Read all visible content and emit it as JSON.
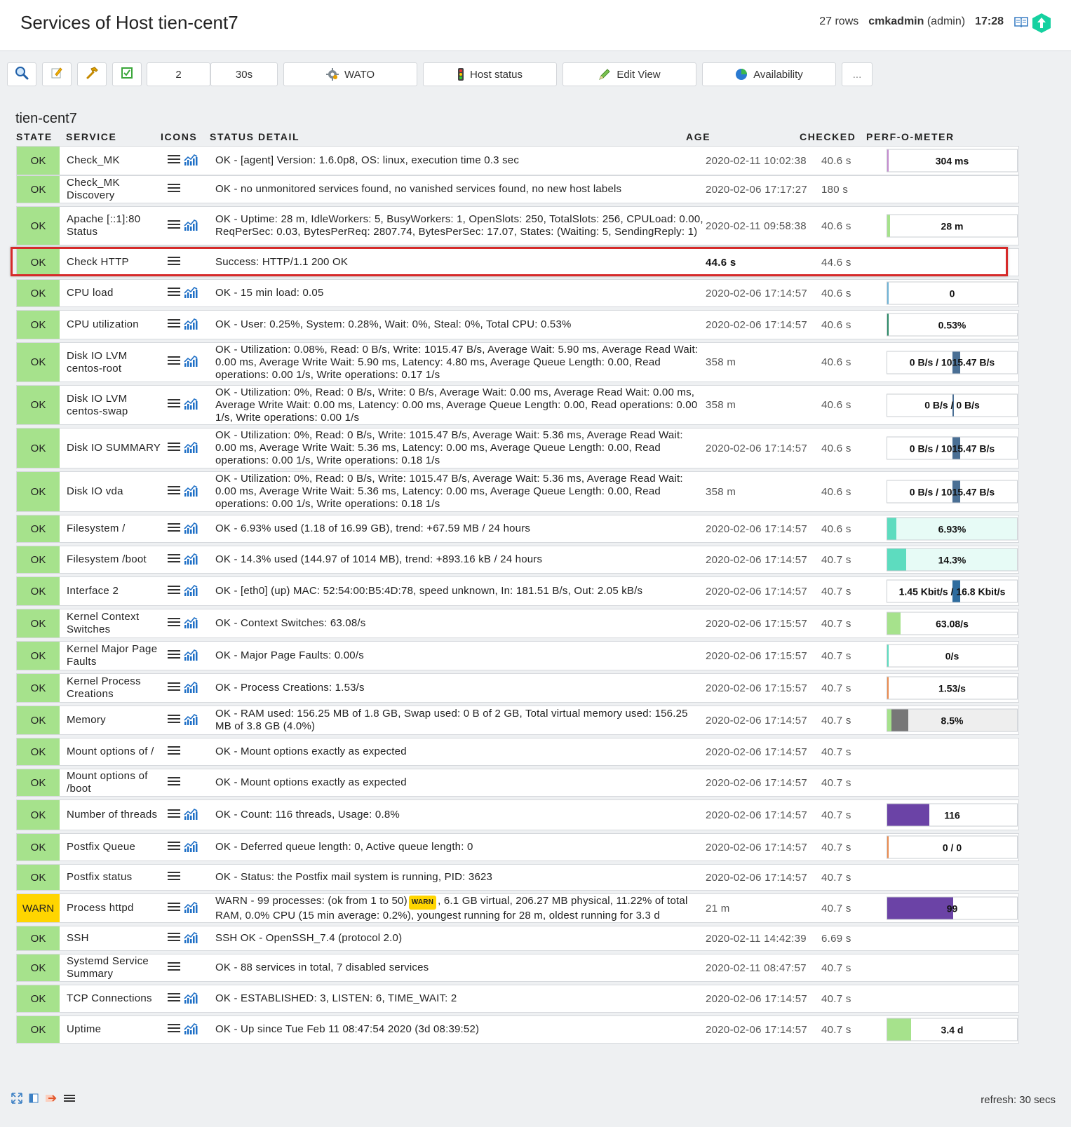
{
  "header": {
    "title": "Services of Host tien-cent7",
    "rows": "27 rows",
    "user": "cmkadmin",
    "role": "(admin)",
    "time": "17:28"
  },
  "toolbar": {
    "refresh_count": "2",
    "refresh_interval": "30s",
    "wato": "WATO",
    "host_status": "Host status",
    "edit_view": "Edit View",
    "availability": "Availability",
    "more": "..."
  },
  "host": "tien-cent7",
  "columns": {
    "state": "STATE",
    "service": "SERVICE",
    "icons": "ICONS",
    "detail": "STATUS DETAIL",
    "age": "AGE",
    "checked": "CHECKED",
    "perf": "PERF-O-METER"
  },
  "services": [
    {
      "state": "OK",
      "service": "Check_MK",
      "detail": "OK - [agent] Version: 1.6.0p8, OS: linux, execution time 0.3 sec",
      "age": "2020-02-11 10:02:38",
      "checked": "40.6 s",
      "perf": "304 ms",
      "graph": true
    },
    {
      "state": "OK",
      "service": "Check_MK Discovery",
      "detail": "OK - no unmonitored services found, no vanished services found, no new host labels",
      "age": "2020-02-06 17:17:27",
      "checked": "180 s",
      "perf": "",
      "graph": false
    },
    {
      "state": "OK",
      "service": "Apache [::1]:80 Status",
      "detail": "OK - Uptime: 28 m, IdleWorkers: 5, BusyWorkers: 1, OpenSlots: 250, TotalSlots: 256, CPULoad: 0.00, ReqPerSec: 0.03, BytesPerReq: 2807.74, BytesPerSec: 17.07, States: (Waiting: 5, SendingReply: 1)",
      "age": "2020-02-11 09:58:38",
      "checked": "40.6 s",
      "perf": "28 m",
      "graph": true
    },
    {
      "state": "OK",
      "service": "Check HTTP",
      "detail": "Success: HTTP/1.1 200 OK",
      "age": "44.6 s",
      "checked": "44.6 s",
      "perf": "",
      "graph": false
    },
    {
      "state": "OK",
      "service": "CPU load",
      "detail": "OK - 15 min load: 0.05",
      "age": "2020-02-06 17:14:57",
      "checked": "40.6 s",
      "perf": "0",
      "graph": true
    },
    {
      "state": "OK",
      "service": "CPU utilization",
      "detail": "OK - User: 0.25%, System: 0.28%, Wait: 0%, Steal: 0%, Total CPU: 0.53%",
      "age": "2020-02-06 17:14:57",
      "checked": "40.6 s",
      "perf": "0.53%",
      "graph": true
    },
    {
      "state": "OK",
      "service": "Disk IO LVM centos-root",
      "detail": "OK - Utilization: 0.08%, Read: 0 B/s, Write: 1015.47 B/s, Average Wait: 5.90 ms, Average Read Wait: 0.00 ms, Average Write Wait: 5.90 ms, Latency: 4.80 ms, Average Queue Length: 0.00, Read operations: 0.00 1/s, Write operations: 0.17 1/s",
      "age": "358 m",
      "checked": "40.6 s",
      "perf": "0 B/s / 1015.47 B/s",
      "graph": true
    },
    {
      "state": "OK",
      "service": "Disk IO LVM centos-swap",
      "detail": "OK - Utilization: 0%, Read: 0 B/s, Write: 0 B/s, Average Wait: 0.00 ms, Average Read Wait: 0.00 ms, Average Write Wait: 0.00 ms, Latency: 0.00 ms, Average Queue Length: 0.00, Read operations: 0.00 1/s, Write operations: 0.00 1/s",
      "age": "358 m",
      "checked": "40.6 s",
      "perf": "0 B/s / 0 B/s",
      "graph": true
    },
    {
      "state": "OK",
      "service": "Disk IO SUMMARY",
      "detail": "OK - Utilization: 0%, Read: 0 B/s, Write: 1015.47 B/s, Average Wait: 5.36 ms, Average Read Wait: 0.00 ms, Average Write Wait: 5.36 ms, Latency: 0.00 ms, Average Queue Length: 0.00, Read operations: 0.00 1/s, Write operations: 0.18 1/s",
      "age": "2020-02-06 17:14:57",
      "checked": "40.6 s",
      "perf": "0 B/s / 1015.47 B/s",
      "graph": true
    },
    {
      "state": "OK",
      "service": "Disk IO vda",
      "detail": "OK - Utilization: 0%, Read: 0 B/s, Write: 1015.47 B/s, Average Wait: 5.36 ms, Average Read Wait: 0.00 ms, Average Write Wait: 5.36 ms, Latency: 0.00 ms, Average Queue Length: 0.00, Read operations: 0.00 1/s, Write operations: 0.18 1/s",
      "age": "358 m",
      "checked": "40.6 s",
      "perf": "0 B/s / 1015.47 B/s",
      "graph": true
    },
    {
      "state": "OK",
      "service": "Filesystem /",
      "detail": "OK - 6.93% used (1.18 of 16.99 GB), trend: +67.59 MB / 24 hours",
      "age": "2020-02-06 17:14:57",
      "checked": "40.6 s",
      "perf": "6.93%",
      "graph": true
    },
    {
      "state": "OK",
      "service": "Filesystem /boot",
      "detail": "OK - 14.3% used (144.97 of 1014 MB), trend: +893.16 kB / 24 hours",
      "age": "2020-02-06 17:14:57",
      "checked": "40.7 s",
      "perf": "14.3%",
      "graph": true
    },
    {
      "state": "OK",
      "service": "Interface 2",
      "detail": "OK - [eth0] (up) MAC: 52:54:00:B5:4D:78, speed unknown, In: 181.51 B/s, Out: 2.05 kB/s",
      "age": "2020-02-06 17:14:57",
      "checked": "40.7 s",
      "perf": "1.45 Kbit/s / 16.8 Kbit/s",
      "graph": true
    },
    {
      "state": "OK",
      "service": "Kernel Context Switches",
      "detail": "OK - Context Switches: 63.08/s",
      "age": "2020-02-06 17:15:57",
      "checked": "40.7 s",
      "perf": "63.08/s",
      "graph": true
    },
    {
      "state": "OK",
      "service": "Kernel Major Page Faults",
      "detail": "OK - Major Page Faults: 0.00/s",
      "age": "2020-02-06 17:15:57",
      "checked": "40.7 s",
      "perf": "0/s",
      "graph": true
    },
    {
      "state": "OK",
      "service": "Kernel Process Creations",
      "detail": "OK - Process Creations: 1.53/s",
      "age": "2020-02-06 17:15:57",
      "checked": "40.7 s",
      "perf": "1.53/s",
      "graph": true
    },
    {
      "state": "OK",
      "service": "Memory",
      "detail": "OK - RAM used: 156.25 MB of 1.8 GB, Swap used: 0 B of 2 GB, Total virtual memory used: 156.25 MB of 3.8 GB (4.0%)",
      "age": "2020-02-06 17:14:57",
      "checked": "40.7 s",
      "perf": "8.5%",
      "graph": true
    },
    {
      "state": "OK",
      "service": "Mount options of /",
      "detail": "OK - Mount options exactly as expected",
      "age": "2020-02-06 17:14:57",
      "checked": "40.7 s",
      "perf": "",
      "graph": false
    },
    {
      "state": "OK",
      "service": "Mount options of /boot",
      "detail": "OK - Mount options exactly as expected",
      "age": "2020-02-06 17:14:57",
      "checked": "40.7 s",
      "perf": "",
      "graph": false
    },
    {
      "state": "OK",
      "service": "Number of threads",
      "detail": "OK - Count: 116 threads, Usage: 0.8%",
      "age": "2020-02-06 17:14:57",
      "checked": "40.7 s",
      "perf": "116",
      "graph": true
    },
    {
      "state": "OK",
      "service": "Postfix Queue",
      "detail": "OK - Deferred queue length: 0, Active queue length: 0",
      "age": "2020-02-06 17:14:57",
      "checked": "40.7 s",
      "perf": "0 / 0",
      "graph": true
    },
    {
      "state": "OK",
      "service": "Postfix status",
      "detail": "OK - Status: the Postfix mail system is running, PID: 3623",
      "age": "2020-02-06 17:14:57",
      "checked": "40.7 s",
      "perf": "",
      "graph": false
    },
    {
      "state": "WARN",
      "service": "Process httpd",
      "detail_pre": "WARN - 99 processes: (ok from 1 to 50)",
      "detail_badge": "WARN",
      "detail_post": ", 6.1 GB virtual, 206.27 MB physical, 11.22% of total RAM, 0.0% CPU (15 min average: 0.2%), youngest running for 28 m, oldest running for 3.3 d",
      "age": "21 m",
      "checked": "40.7 s",
      "perf": "99",
      "graph": true
    },
    {
      "state": "OK",
      "service": "SSH",
      "detail": "SSH OK - OpenSSH_7.4 (protocol 2.0)",
      "age": "2020-02-11 14:42:39",
      "checked": "6.69 s",
      "perf": "",
      "graph": true
    },
    {
      "state": "OK",
      "service": "Systemd Service Summary",
      "detail": "OK - 88 services in total, 7 disabled services",
      "age": "2020-02-11 08:47:57",
      "checked": "40.7 s",
      "perf": "",
      "graph": false
    },
    {
      "state": "OK",
      "service": "TCP Connections",
      "detail": "OK - ESTABLISHED: 3, LISTEN: 6, TIME_WAIT: 2",
      "age": "2020-02-06 17:14:57",
      "checked": "40.7 s",
      "perf": "",
      "graph": true
    },
    {
      "state": "OK",
      "service": "Uptime",
      "detail": "OK - Up since Tue Feb 11 08:47:54 2020 (3d 08:39:52)",
      "age": "2020-02-06 17:14:57",
      "checked": "40.7 s",
      "perf": "3.4 d",
      "graph": true
    }
  ],
  "perf_meters": {
    "0": {
      "fill": 0.01,
      "color": "#c38bcf"
    },
    "2": {
      "fill": 0.02,
      "color": "#a6e28c"
    },
    "4": {
      "fill": 0.005,
      "color": "#6fb3d6"
    },
    "5": {
      "fill": 0.01,
      "color": "#2d8a67"
    },
    "6": {
      "split": true,
      "fill": 0.06,
      "color": "#4a6f94"
    },
    "7": {
      "split": true,
      "fill": 0.01,
      "color": "#4a6f94"
    },
    "8": {
      "split": true,
      "fill": 0.06,
      "color": "#4a6f94"
    },
    "9": {
      "split": true,
      "fill": 0.06,
      "color": "#4a6f94"
    },
    "10": {
      "fill": 0.0693,
      "color": "#5ddcbf",
      "bg": "#e7fbf6"
    },
    "11": {
      "fill": 0.143,
      "color": "#5ddcbf",
      "bg": "#e7fbf6"
    },
    "12": {
      "split": true,
      "fill": 0.06,
      "color": "#2f6c9e"
    },
    "13": {
      "fill": 0.1,
      "color": "#a6e28c"
    },
    "14": {
      "fill": 0.005,
      "color": "#5ddcbf"
    },
    "15": {
      "fill": 0.01,
      "color": "#e98b50"
    },
    "16": {
      "fill": 0.085,
      "color": "#777",
      "bg": "#eeeeee",
      "lead": "#a6e28c"
    },
    "19": {
      "fill": 0.32,
      "color": "#6b43a6"
    },
    "20": {
      "fill": 0.005,
      "color": "#e98b50"
    },
    "22": {
      "fill": 0.5,
      "color": "#6b43a6"
    },
    "26": {
      "fill": 0.18,
      "color": "#a6e28c"
    }
  },
  "footer": {
    "refresh": "refresh: 30 secs"
  }
}
